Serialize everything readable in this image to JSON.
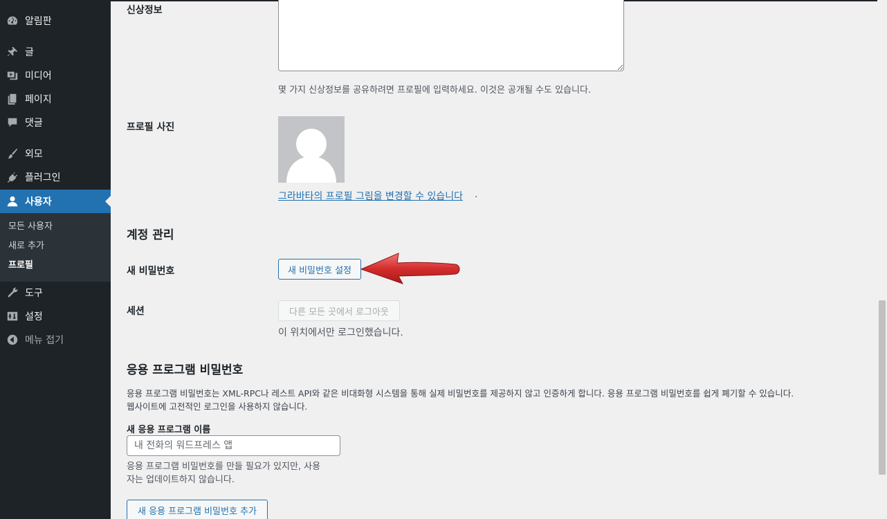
{
  "sidebar": {
    "items": [
      {
        "label": "알림판",
        "icon": "dashboard-icon"
      },
      {
        "label": "글",
        "icon": "pin-icon"
      },
      {
        "label": "미디어",
        "icon": "media-icon"
      },
      {
        "label": "페이지",
        "icon": "pages-icon"
      },
      {
        "label": "댓글",
        "icon": "comments-icon"
      },
      {
        "label": "외모",
        "icon": "brush-icon"
      },
      {
        "label": "플러그인",
        "icon": "plugin-icon"
      },
      {
        "label": "사용자",
        "icon": "user-icon"
      },
      {
        "label": "도구",
        "icon": "wrench-icon"
      },
      {
        "label": "설정",
        "icon": "settings-icon"
      },
      {
        "label": "메뉴 접기",
        "icon": "collapse-icon"
      }
    ],
    "submenu": [
      "모든 사용자",
      "새로 추가",
      "프로필"
    ]
  },
  "bio": {
    "label": "신상정보",
    "help": "몇 가지 신상정보를 공유하려면 프로필에 입력하세요. 이것은 공개될 수도 있습니다."
  },
  "profile_picture": {
    "label": "프로필 사진",
    "link": "그라바타의 프로필 그림을 변경할 수 있습니다",
    "link_suffix": "."
  },
  "account": {
    "heading": "계정 관리",
    "new_password_label": "새 비밀번호",
    "new_password_button": "새 비밀번호 설정",
    "sessions_label": "세션",
    "logout_button": "다른 모든 곳에서 로그아웃",
    "sessions_note": "이 위치에서만 로그인했습니다."
  },
  "app_passwords": {
    "heading": "응용 프로그램 비밀번호",
    "desc_line1": "응용 프로그램 비밀번호는 XML-RPC나 레스트 API와 같은 비대화형 시스템을 통해 실제 비밀번호를 제공하지 않고 인증하게 합니다. 응용 프로그램 비밀번호를 쉽게 폐기할 수 있습니다.",
    "desc_line2": "웹사이트에 고전적인 로그인을 사용하지 않습니다.",
    "name_label": "새 응용 프로그램 이름",
    "name_placeholder": "내 전화의 워드프레스 앱",
    "name_help_line1": "응용 프로그램 비밀번호를 만들 필요가 있지만, 사용",
    "name_help_line2": "자는 업데이트하지 않습니다.",
    "add_button": "새 응용 프로그램 비밀번호 추가"
  },
  "colors": {
    "sidebar_bg": "#1d2327",
    "accent": "#2271b1",
    "page_bg": "#f0f0f1",
    "arrow": "#d42d2d"
  }
}
